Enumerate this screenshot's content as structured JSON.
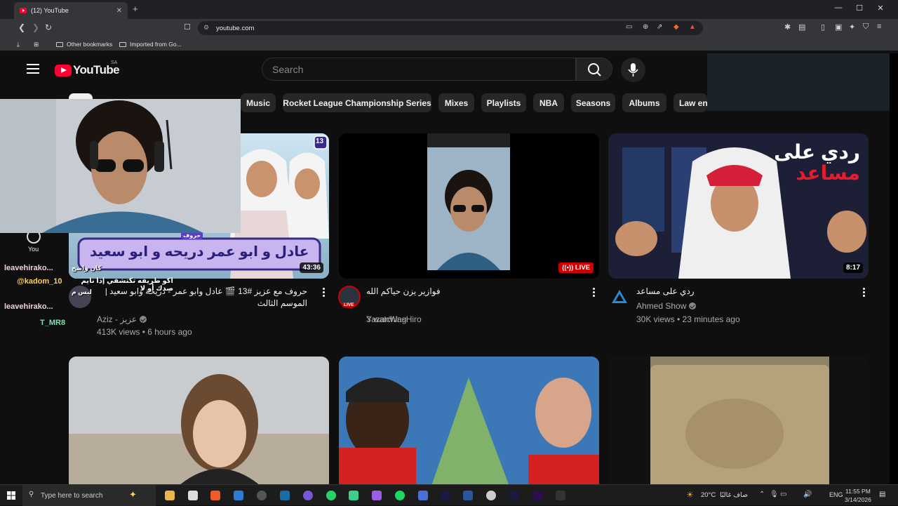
{
  "browser": {
    "tab_title": "(12) YouTube",
    "tab_close": "✕",
    "new_tab": "+",
    "url": "youtube.com",
    "bookmarks": [
      "Other bookmarks",
      "Imported from Go..."
    ],
    "window_controls": [
      "—",
      "☐",
      "✕"
    ]
  },
  "youtube": {
    "logo_text": "YouTube",
    "country_code": "SA",
    "search_placeholder": "Search",
    "chips": [
      "Music",
      "Rocket League Championship Series",
      "Mixes",
      "Playlists",
      "NBA",
      "Seasons",
      "Albums",
      "Law enf"
    ],
    "sidebar": {
      "you_label": "You"
    }
  },
  "videos": [
    {
      "title": "حروف مع عزيز #13 🎬 عادل وابو عمر - دريحة وابو سعيد | الموسم الثالث",
      "channel": "Aziz - عزيز",
      "verified": true,
      "meta": "413K views • 6 hours ago",
      "duration": "43:36",
      "thumb_text": "عادل و ابو عمر دريحه و ابو سعيد",
      "thumb_badge": "13",
      "thumb_tag": "حروف"
    },
    {
      "title": "فوازير يزن حياكم الله",
      "channel": "YazanWasHiro",
      "verified": false,
      "meta": "3 watching",
      "live_badge": "LIVE",
      "avatar_badge": "LIVE"
    },
    {
      "title": "ردي على مساعد",
      "channel": "Ahmed Show",
      "verified": true,
      "meta": "30K views • 23 minutes ago",
      "duration": "8:17",
      "thumb_text_line1": "ردي على",
      "thumb_text_line2": "مساعد"
    }
  ],
  "chat": [
    {
      "name": "leavehirako...",
      "color": "#f0d0e0",
      "msg": "كان واضح"
    },
    {
      "name": "@kadom_10",
      "color": "#ffd24d",
      "msg": "اكو طريقه تكتشفي إذا نايم صدك أو لا"
    },
    {
      "name": "leavehirako...",
      "color": "#f0d0e0",
      "msg": "ليس م"
    },
    {
      "name": "T_MR8",
      "color": "#7ee0b0",
      "msg": ""
    }
  ],
  "taskbar": {
    "search_placeholder": "Type here to search",
    "weather": "20°C",
    "weather_text": "صاف غالبًا",
    "language": "ENG",
    "time": "11:55 PM",
    "date": "3/14/2026"
  },
  "colors": {
    "youtube_red": "#ff0033",
    "page_bg": "#0f0f0f",
    "chip_bg": "#272727",
    "live_red": "#cc0000"
  }
}
